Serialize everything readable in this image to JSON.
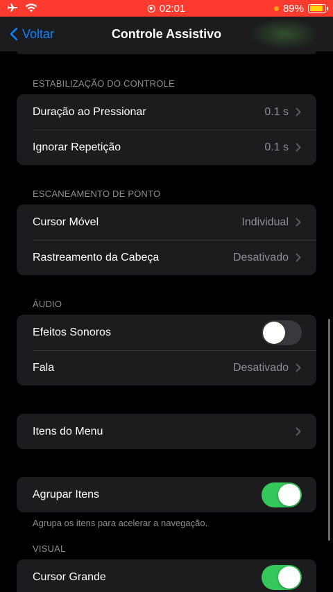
{
  "status_bar": {
    "time": "02:01",
    "battery": "89%",
    "airplane_icon": "airplane-icon",
    "wifi_icon": "wifi-icon",
    "colors": {
      "background": "#ff3b30",
      "battery_fill": "#ffd60a",
      "indicator": "#ff9f0a"
    }
  },
  "nav": {
    "back_label": "Voltar",
    "title": "Controle Assistivo",
    "accent": "#0a84ff"
  },
  "sections": {
    "estabilizacao": {
      "header": "ESTABILIZAÇÃO DO CONTROLE",
      "rows": [
        {
          "label": "Duração ao Pressionar",
          "value": "0.1 s"
        },
        {
          "label": "Ignorar Repetição",
          "value": "0.1 s"
        }
      ]
    },
    "escaneamento": {
      "header": "ESCANEAMENTO DE PONTO",
      "rows": [
        {
          "label": "Cursor Móvel",
          "value": "Individual"
        },
        {
          "label": "Rastreamento da Cabeça",
          "value": "Desativado"
        }
      ]
    },
    "audio": {
      "header": "ÁUDIO",
      "rows": [
        {
          "label": "Efeitos Sonoros",
          "toggle": false
        },
        {
          "label": "Fala",
          "value": "Desativado"
        }
      ]
    },
    "menu": {
      "rows": [
        {
          "label": "Itens do Menu"
        }
      ]
    },
    "agrupar": {
      "rows": [
        {
          "label": "Agrupar Itens",
          "toggle": true
        }
      ],
      "footer": "Agrupa os itens para acelerar a navegação."
    },
    "visual": {
      "header": "VISUAL",
      "rows": [
        {
          "label": "Cursor Grande",
          "toggle": true
        }
      ]
    }
  },
  "colors": {
    "toggle_on": "#34c759",
    "toggle_off": "#39393d",
    "cell_bg": "#1c1c1e"
  }
}
